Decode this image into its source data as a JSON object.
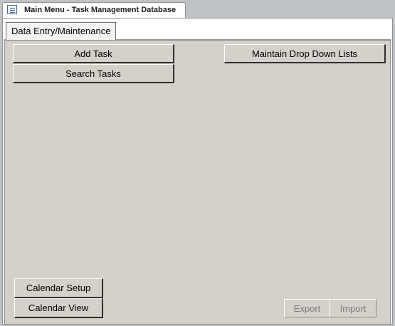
{
  "window": {
    "title": "Main Menu - Task Management Database",
    "icon": "form-icon"
  },
  "tabs": [
    {
      "label": "Data Entry/Maintenance",
      "selected": true
    }
  ],
  "buttons": {
    "add_task": "Add Task",
    "search_tasks": "Search Tasks",
    "maintain_drop_down_lists": "Maintain Drop Down Lists",
    "calendar_setup": "Calendar Setup",
    "calendar_view": "Calendar View",
    "export": "Export",
    "import": "Import"
  },
  "states": {
    "export_enabled": false,
    "import_enabled": false
  },
  "colors": {
    "form_background": "#d5d0c9",
    "disabled_text": "#7b7b7b"
  }
}
